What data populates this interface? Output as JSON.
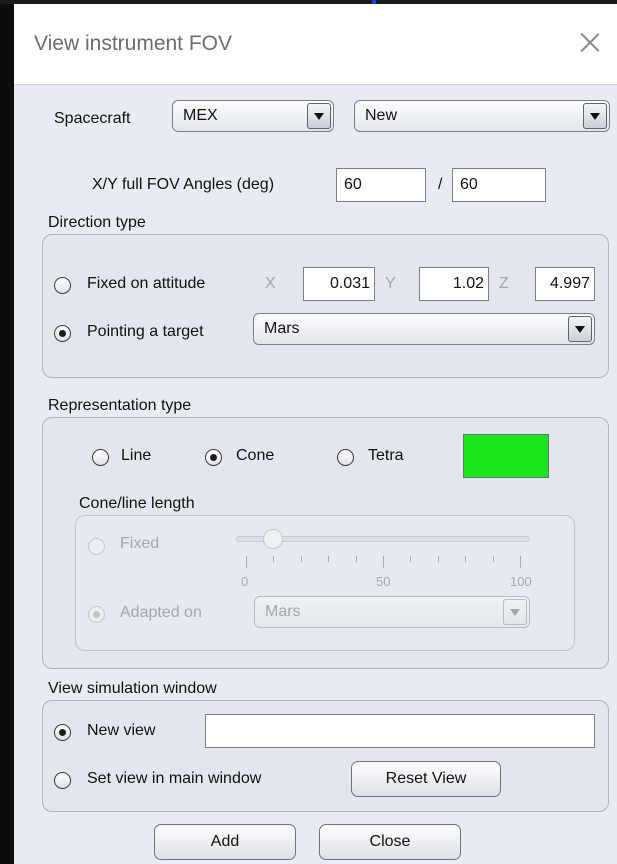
{
  "dialog": {
    "title": "View instrument FOV"
  },
  "spacecraft": {
    "label": "Spacecraft",
    "value": "MEX",
    "instrument_value": "New"
  },
  "fov": {
    "label": "X/Y full FOV Angles (deg)",
    "x": "60",
    "separator": "/",
    "y": "60"
  },
  "direction": {
    "group_label": "Direction type",
    "fixed_label": "Fixed on attitude",
    "x_label": "X",
    "x_value": "0.031",
    "y_label": "Y",
    "y_value": "1.02",
    "z_label": "Z",
    "z_value": "4.997",
    "pointing_label": "Pointing a target",
    "target_value": "Mars",
    "selected": "pointing"
  },
  "representation": {
    "group_label": "Representation type",
    "options": [
      "Line",
      "Cone",
      "Tetra"
    ],
    "selected": "Cone",
    "color": "#1be61b",
    "length": {
      "group_label": "Cone/line length",
      "fixed_label": "Fixed",
      "slider": {
        "min": "0",
        "mid": "50",
        "max": "100",
        "value": 10
      },
      "adapted_label": "Adapted on",
      "adapted_value": "Mars"
    }
  },
  "view": {
    "group_label": "View simulation window",
    "new_view_label": "New view",
    "new_view_value": "",
    "set_view_label": "Set view in main window",
    "reset_label": "Reset View"
  },
  "buttons": {
    "add": "Add",
    "close": "Close"
  }
}
